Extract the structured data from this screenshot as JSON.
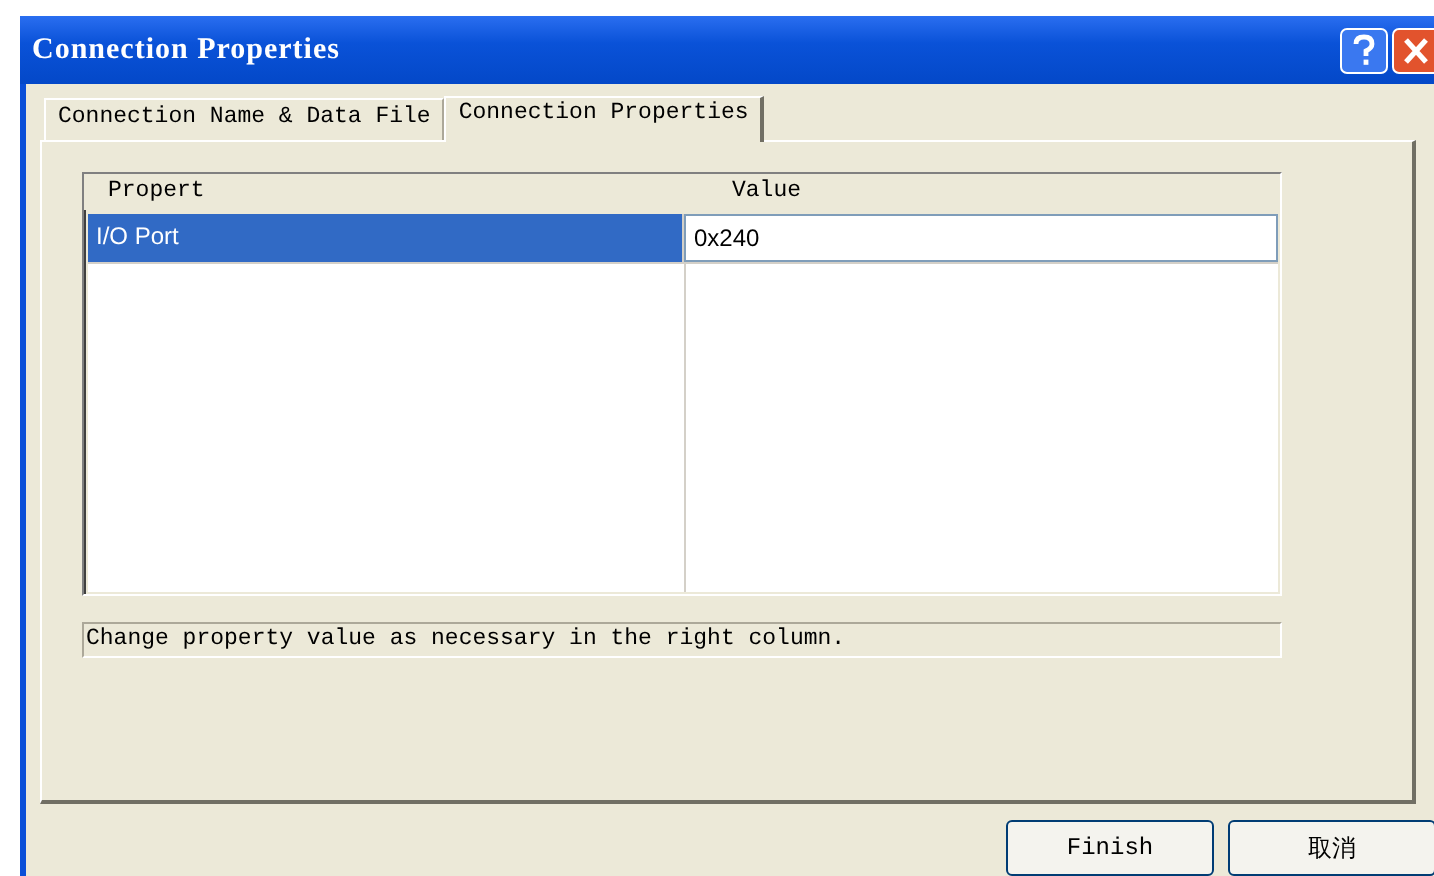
{
  "window": {
    "title": "Connection Properties"
  },
  "tabs": [
    {
      "label": "Connection Name & Data File",
      "selected": false
    },
    {
      "label": "Connection Properties",
      "selected": true
    }
  ],
  "grid": {
    "columns": [
      "Propert",
      "Value"
    ],
    "rows": [
      {
        "cells": [
          "I/O Port",
          "0x240"
        ],
        "selected": true
      }
    ]
  },
  "hint": "Change property value as necessary in the right column.",
  "buttons": [
    "Finish",
    "取消"
  ]
}
